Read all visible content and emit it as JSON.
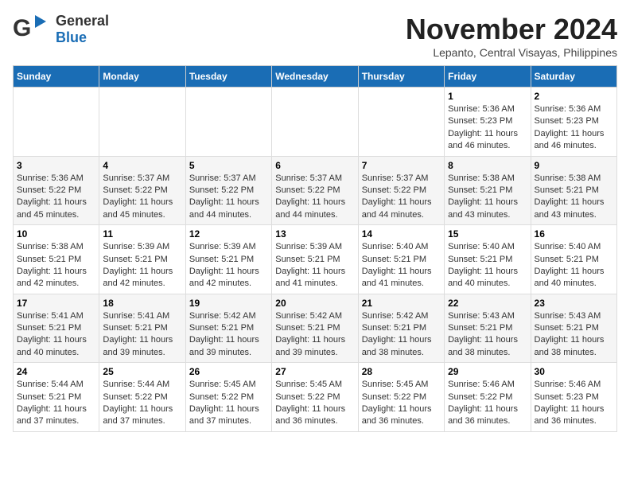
{
  "logo": {
    "general": "General",
    "blue": "Blue"
  },
  "title": "November 2024",
  "location": "Lepanto, Central Visayas, Philippines",
  "weekdays": [
    "Sunday",
    "Monday",
    "Tuesday",
    "Wednesday",
    "Thursday",
    "Friday",
    "Saturday"
  ],
  "weeks": [
    [
      {
        "day": "",
        "info": ""
      },
      {
        "day": "",
        "info": ""
      },
      {
        "day": "",
        "info": ""
      },
      {
        "day": "",
        "info": ""
      },
      {
        "day": "",
        "info": ""
      },
      {
        "day": "1",
        "info": "Sunrise: 5:36 AM\nSunset: 5:23 PM\nDaylight: 11 hours and 46 minutes."
      },
      {
        "day": "2",
        "info": "Sunrise: 5:36 AM\nSunset: 5:23 PM\nDaylight: 11 hours and 46 minutes."
      }
    ],
    [
      {
        "day": "3",
        "info": "Sunrise: 5:36 AM\nSunset: 5:22 PM\nDaylight: 11 hours and 45 minutes."
      },
      {
        "day": "4",
        "info": "Sunrise: 5:37 AM\nSunset: 5:22 PM\nDaylight: 11 hours and 45 minutes."
      },
      {
        "day": "5",
        "info": "Sunrise: 5:37 AM\nSunset: 5:22 PM\nDaylight: 11 hours and 44 minutes."
      },
      {
        "day": "6",
        "info": "Sunrise: 5:37 AM\nSunset: 5:22 PM\nDaylight: 11 hours and 44 minutes."
      },
      {
        "day": "7",
        "info": "Sunrise: 5:37 AM\nSunset: 5:22 PM\nDaylight: 11 hours and 44 minutes."
      },
      {
        "day": "8",
        "info": "Sunrise: 5:38 AM\nSunset: 5:21 PM\nDaylight: 11 hours and 43 minutes."
      },
      {
        "day": "9",
        "info": "Sunrise: 5:38 AM\nSunset: 5:21 PM\nDaylight: 11 hours and 43 minutes."
      }
    ],
    [
      {
        "day": "10",
        "info": "Sunrise: 5:38 AM\nSunset: 5:21 PM\nDaylight: 11 hours and 42 minutes."
      },
      {
        "day": "11",
        "info": "Sunrise: 5:39 AM\nSunset: 5:21 PM\nDaylight: 11 hours and 42 minutes."
      },
      {
        "day": "12",
        "info": "Sunrise: 5:39 AM\nSunset: 5:21 PM\nDaylight: 11 hours and 42 minutes."
      },
      {
        "day": "13",
        "info": "Sunrise: 5:39 AM\nSunset: 5:21 PM\nDaylight: 11 hours and 41 minutes."
      },
      {
        "day": "14",
        "info": "Sunrise: 5:40 AM\nSunset: 5:21 PM\nDaylight: 11 hours and 41 minutes."
      },
      {
        "day": "15",
        "info": "Sunrise: 5:40 AM\nSunset: 5:21 PM\nDaylight: 11 hours and 40 minutes."
      },
      {
        "day": "16",
        "info": "Sunrise: 5:40 AM\nSunset: 5:21 PM\nDaylight: 11 hours and 40 minutes."
      }
    ],
    [
      {
        "day": "17",
        "info": "Sunrise: 5:41 AM\nSunset: 5:21 PM\nDaylight: 11 hours and 40 minutes."
      },
      {
        "day": "18",
        "info": "Sunrise: 5:41 AM\nSunset: 5:21 PM\nDaylight: 11 hours and 39 minutes."
      },
      {
        "day": "19",
        "info": "Sunrise: 5:42 AM\nSunset: 5:21 PM\nDaylight: 11 hours and 39 minutes."
      },
      {
        "day": "20",
        "info": "Sunrise: 5:42 AM\nSunset: 5:21 PM\nDaylight: 11 hours and 39 minutes."
      },
      {
        "day": "21",
        "info": "Sunrise: 5:42 AM\nSunset: 5:21 PM\nDaylight: 11 hours and 38 minutes."
      },
      {
        "day": "22",
        "info": "Sunrise: 5:43 AM\nSunset: 5:21 PM\nDaylight: 11 hours and 38 minutes."
      },
      {
        "day": "23",
        "info": "Sunrise: 5:43 AM\nSunset: 5:21 PM\nDaylight: 11 hours and 38 minutes."
      }
    ],
    [
      {
        "day": "24",
        "info": "Sunrise: 5:44 AM\nSunset: 5:21 PM\nDaylight: 11 hours and 37 minutes."
      },
      {
        "day": "25",
        "info": "Sunrise: 5:44 AM\nSunset: 5:22 PM\nDaylight: 11 hours and 37 minutes."
      },
      {
        "day": "26",
        "info": "Sunrise: 5:45 AM\nSunset: 5:22 PM\nDaylight: 11 hours and 37 minutes."
      },
      {
        "day": "27",
        "info": "Sunrise: 5:45 AM\nSunset: 5:22 PM\nDaylight: 11 hours and 36 minutes."
      },
      {
        "day": "28",
        "info": "Sunrise: 5:45 AM\nSunset: 5:22 PM\nDaylight: 11 hours and 36 minutes."
      },
      {
        "day": "29",
        "info": "Sunrise: 5:46 AM\nSunset: 5:22 PM\nDaylight: 11 hours and 36 minutes."
      },
      {
        "day": "30",
        "info": "Sunrise: 5:46 AM\nSunset: 5:23 PM\nDaylight: 11 hours and 36 minutes."
      }
    ]
  ]
}
